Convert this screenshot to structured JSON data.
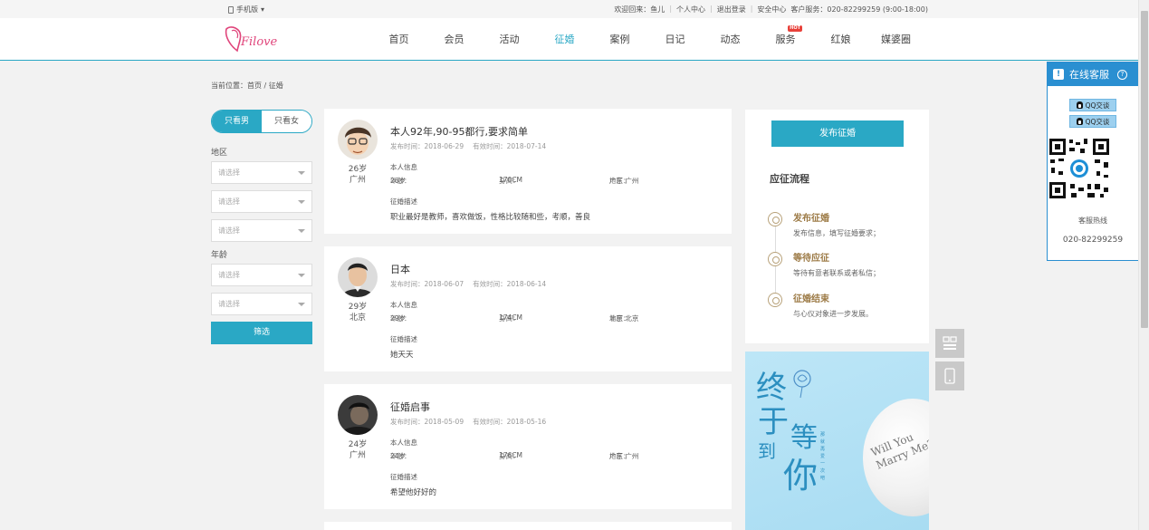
{
  "topbar": {
    "mobile_label": "手机版",
    "welcome": "欢迎回来：鱼儿",
    "user_center": "个人中心",
    "logout": "退出登录",
    "security": "安全中心",
    "service": "客户服务：020-82299259 (9:00-18:00)"
  },
  "nav": {
    "items": [
      "首页",
      "会员",
      "活动",
      "征婚",
      "案例",
      "日记",
      "动态",
      "服务",
      "红娘",
      "媒婆圈"
    ],
    "active_index": 3,
    "hot_badge": "HOT"
  },
  "breadcrumb": "当前位置：首页 / 征婚",
  "filter": {
    "toggle_male": "只看男",
    "toggle_female": "只看女",
    "region_label": "地区",
    "age_label": "年龄",
    "placeholder": "请选择",
    "submit": "筛选"
  },
  "cards": [
    {
      "title": "本人92年,90-95都行,要求简单",
      "publish": "发布时间：2018-06-29",
      "valid": "有效时间：2018-07-14",
      "age": "26岁",
      "city": "广州",
      "info_label": "本人信息",
      "age_field_label": "年龄：",
      "age_field_value": "26岁",
      "height_label": "身高：",
      "height_value": "170CM",
      "region_label": "地区：",
      "region_value": "广东 广州",
      "desc_label": "征婚描述",
      "desc": "职业最好是教师，喜欢做饭，性格比较随和些，考顺，善良"
    },
    {
      "title": "日本",
      "publish": "发布时间：2018-06-07",
      "valid": "有效时间：2018-06-14",
      "age": "29岁",
      "city": "北京",
      "info_label": "本人信息",
      "age_field_label": "年龄：",
      "age_field_value": "29岁",
      "height_label": "身高：",
      "height_value": "174CM",
      "region_label": "地区：",
      "region_value": "北京 北京",
      "desc_label": "征婚描述",
      "desc": "她天天"
    },
    {
      "title": "征婚启事",
      "publish": "发布时间：2018-05-09",
      "valid": "有效时间：2018-05-16",
      "age": "24岁",
      "city": "广州",
      "info_label": "本人信息",
      "age_field_label": "年龄：",
      "age_field_value": "24岁",
      "height_label": "身高：",
      "height_value": "176CM",
      "region_label": "地区：",
      "region_value": "广东 广州",
      "desc_label": "征婚描述",
      "desc": "希望他好好的"
    }
  ],
  "sidebar": {
    "publish_button": "发布征婚",
    "process_title": "应征流程",
    "steps": [
      {
        "title": "发布征婚",
        "desc": "发布信息，填写征婚要求；"
      },
      {
        "title": "等待应征",
        "desc": "等待有意者联系或者私信；"
      },
      {
        "title": "征婚结束",
        "desc": "与心仪对象进一步发展。"
      }
    ]
  },
  "banner": {
    "chars": [
      "终",
      "于",
      "等",
      "到",
      "你"
    ],
    "vertical": "那就 再爱一次 吧",
    "balloon_line1": "Will You",
    "balloon_line2": "Marry Me?"
  },
  "customer_service": {
    "title": "在线客服",
    "qq1": "QQ交谈",
    "qq2": "QQ交谈",
    "hotline_label": "客服热线",
    "hotline": "020-82299259"
  },
  "colors": {
    "accent": "#2aa8c5",
    "cs_blue": "#2a8fd1",
    "step_gold": "#9c7a45",
    "hot_red": "#e8413a"
  }
}
